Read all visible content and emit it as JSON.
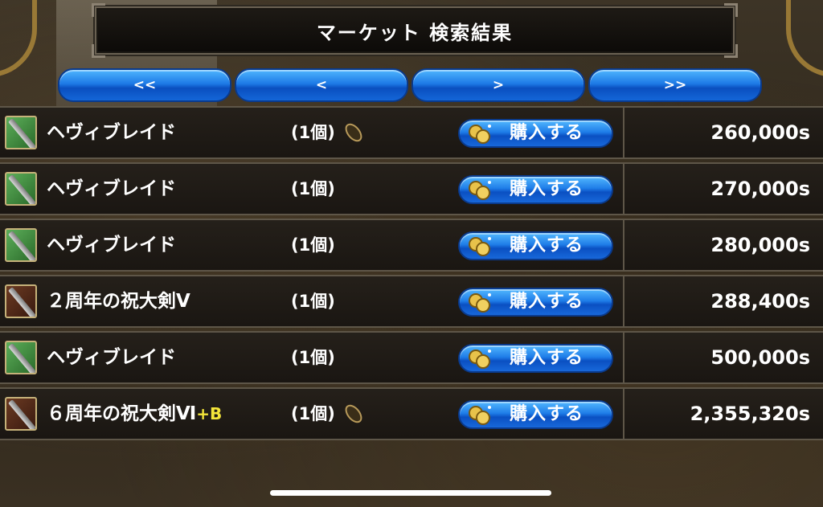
{
  "title": "マーケット 検索結果",
  "pager": {
    "first_label": "<<",
    "prev_label": "<",
    "next_label": ">",
    "last_label": ">>"
  },
  "buy_label": "購入する",
  "colors": {
    "button_blue": "#1d7ae6",
    "icon_green": "#3e8c3c",
    "icon_brown": "#5a2e1a",
    "plus_yellow": "#f5e63a"
  },
  "items": [
    {
      "name": "ヘヴィブレイド",
      "suffix": "",
      "qty": "(1個)",
      "has_seed_icon": true,
      "icon": "green-sword-icon",
      "price": "260,000s"
    },
    {
      "name": "ヘヴィブレイド",
      "suffix": "",
      "qty": "(1個)",
      "has_seed_icon": false,
      "icon": "green-sword-icon",
      "price": "270,000s"
    },
    {
      "name": "ヘヴィブレイド",
      "suffix": "",
      "qty": "(1個)",
      "has_seed_icon": false,
      "icon": "green-sword-icon",
      "price": "280,000s"
    },
    {
      "name": "２周年の祝大剣Ⅴ",
      "suffix": "",
      "qty": "(1個)",
      "has_seed_icon": false,
      "icon": "brown-sword-icon",
      "price": "288,400s"
    },
    {
      "name": "ヘヴィブレイド",
      "suffix": "",
      "qty": "(1個)",
      "has_seed_icon": false,
      "icon": "green-sword-icon",
      "price": "500,000s"
    },
    {
      "name": "６周年の祝大剣Ⅵ",
      "suffix": "+B",
      "qty": "(1個)",
      "has_seed_icon": true,
      "icon": "brown-sword-icon",
      "price": "2,355,320s"
    }
  ]
}
